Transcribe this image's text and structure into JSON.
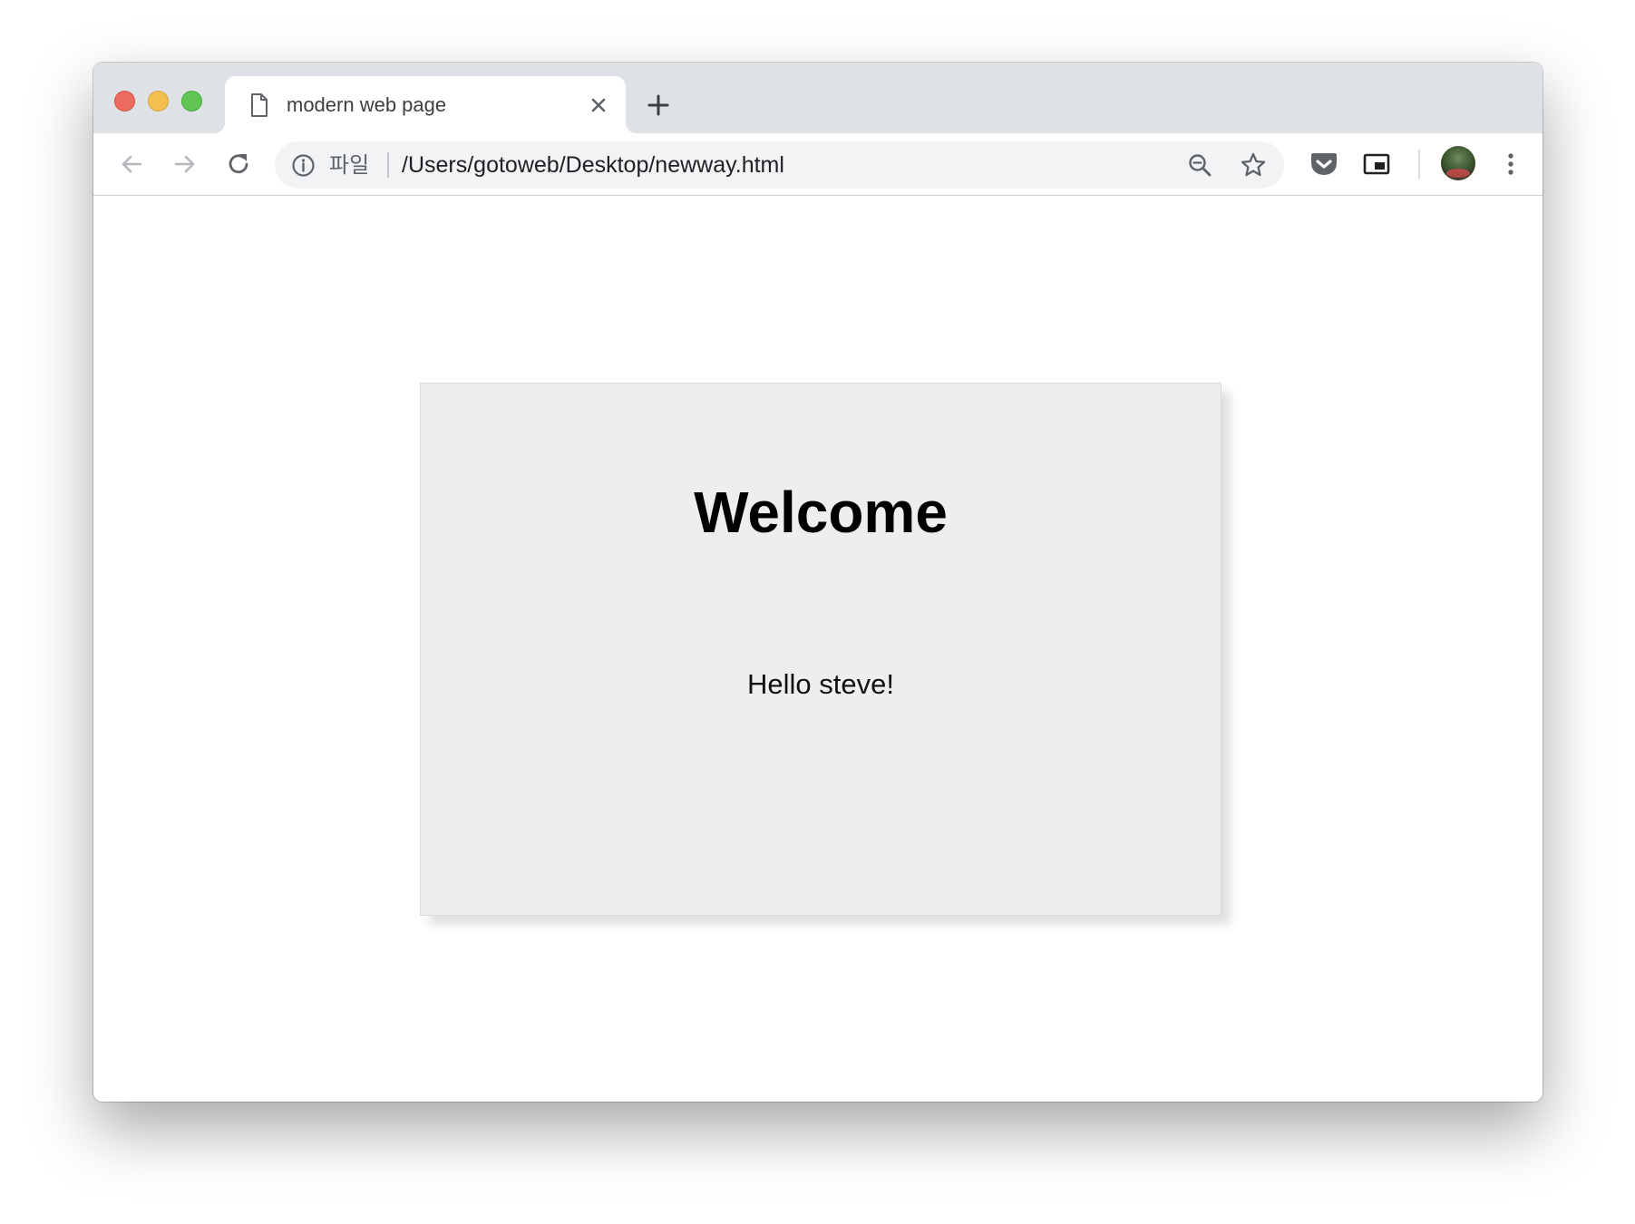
{
  "browser": {
    "tab": {
      "title": "modern web page"
    },
    "omnibox": {
      "scheme_label": "파일",
      "url": "/Users/gotoweb/Desktop/newway.html"
    }
  },
  "page": {
    "heading": "Welcome",
    "greeting": "Hello steve!"
  },
  "colors": {
    "tabstrip_bg": "#dee1e6",
    "omnibox_bg": "#f1f3f4",
    "card_bg": "#eeeeee",
    "traffic_close": "#ed6a5e",
    "traffic_minimize": "#f5bf4f",
    "traffic_maximize": "#61c554"
  },
  "icons": {
    "tab": [
      "document-icon",
      "close-icon",
      "plus-icon"
    ],
    "toolbar": [
      "back-arrow-icon",
      "forward-arrow-icon",
      "reload-icon",
      "info-icon",
      "zoom-out-icon",
      "star-icon",
      "pocket-icon",
      "picture-in-picture-icon",
      "avatar",
      "more-vert-icon"
    ]
  }
}
